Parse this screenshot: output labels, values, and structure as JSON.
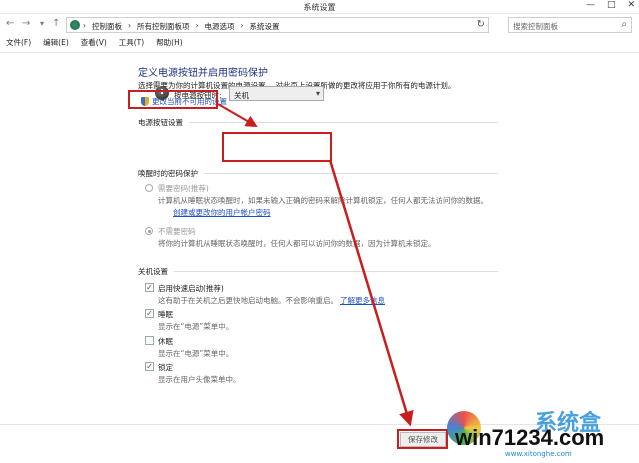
{
  "window": {
    "title": "系统设置",
    "controls": [
      "—",
      "□",
      "✕"
    ]
  },
  "address": {
    "breadcrumbs": [
      "控制面板",
      "所有控制面板项",
      "电源选项",
      "系统设置"
    ],
    "search_placeholder": "搜索控制面板"
  },
  "menu": [
    "文件(F)",
    "编辑(E)",
    "查看(V)",
    "工具(T)",
    "帮助(H)"
  ],
  "main": {
    "heading": "定义电源按钮并启用密码保护",
    "subheading": "选择需要为你的计算机设置的电源设置。 对此页上设置所做的更改将应用于你所有的电源计划。",
    "change_link": "更改当前不可用的设置",
    "power_section": {
      "title": "电源按钮设置",
      "label": "按电源按钮时:",
      "selected": "关机"
    },
    "password_section": {
      "title": "唤醒时的密码保护",
      "options": [
        {
          "label": "需要密码(推荐)",
          "desc": "计算机从睡眠状态唤醒时，如果未输入正确的密码来解除计算机锁定，任何人都无法访问你的数据。",
          "link": "创建或更改你的用户帐户密码",
          "selected": false
        },
        {
          "label": "不需要密码",
          "desc": "将你的计算机从睡眠状态唤醒时，任何人都可以访问你的数据，因为计算机未锁定。",
          "selected": true
        }
      ]
    },
    "shutdown_section": {
      "title": "关机设置",
      "items": [
        {
          "label": "启用快速启动(推荐)",
          "desc": "这有助于在关机之后更快地启动电脑。不会影响重启。",
          "link": "了解更多信息",
          "checked": true
        },
        {
          "label": "睡眠",
          "desc": "显示在“电源”菜单中。",
          "checked": true
        },
        {
          "label": "休眠",
          "desc": "显示在“电源”菜单中。",
          "checked": false
        },
        {
          "label": "锁定",
          "desc": "显示在用户头像菜单中。",
          "checked": true
        }
      ]
    },
    "save_button": "保存修改"
  },
  "watermark": {
    "site": "win71234.com",
    "brand": "系统盒",
    "url": "www.xitonghe.com"
  },
  "colors": {
    "annotation": "#c81e1e",
    "heading": "#1e3287",
    "link": "#1e50c8"
  }
}
